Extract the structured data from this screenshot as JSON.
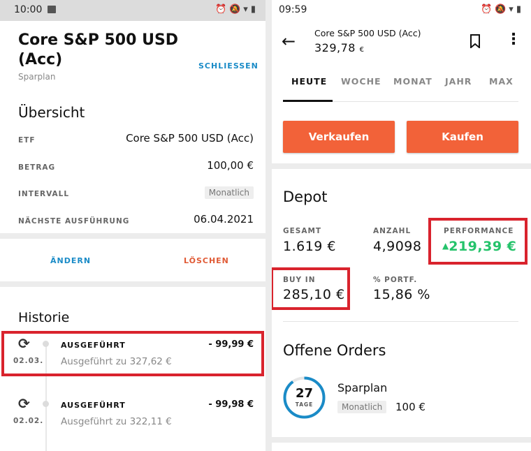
{
  "left": {
    "status_time": "10:00",
    "title": "Core S&P 500 USD (Acc)",
    "subtitle": "Sparplan",
    "close_label": "SCHLIESSEN",
    "overview_heading": "Übersicht",
    "rows": [
      {
        "label": "ETF",
        "value": "Core S&P 500 USD (Acc)"
      },
      {
        "label": "BETRAG",
        "value": "100,00 €"
      },
      {
        "label": "INTERVALL",
        "value": "Monatlich"
      },
      {
        "label": "NÄCHSTE AUSFÜHRUNG",
        "value": "06.04.2021"
      }
    ],
    "edit_label": "ÄNDERN",
    "delete_label": "LÖSCHEN",
    "history_heading": "Historie",
    "history": [
      {
        "date": "02.03.",
        "title": "AUSGEFÜHRT",
        "amount": "- 99,99 €",
        "detail": "Ausgeführt zu 327,62 €"
      },
      {
        "date": "02.02.",
        "title": "AUSGEFÜHRT",
        "amount": "- 99,98 €",
        "detail": "Ausgeführt zu 322,11 €"
      }
    ]
  },
  "right": {
    "status_time": "09:59",
    "header_name": "Core S&P 500 USD (Acc)",
    "header_price": "329,78",
    "header_currency": "€",
    "tabs": [
      "HEUTE",
      "WOCHE",
      "MONAT",
      "JAHR",
      "MAX"
    ],
    "active_tab": "HEUTE",
    "sell_label": "Verkaufen",
    "buy_label": "Kaufen",
    "depot_heading": "Depot",
    "depot": {
      "gesamt_label": "GESAMT",
      "gesamt": "1.619 €",
      "anzahl_label": "ANZAHL",
      "anzahl": "4,9098",
      "performance_label": "PERFORMANCE",
      "performance": "219,39 €",
      "buyin_label": "BUY IN",
      "buyin": "285,10 €",
      "portf_label": "% PORTF.",
      "portf": "15,86 %"
    },
    "orders_heading": "Offene Orders",
    "order": {
      "days": "27",
      "days_label": "TAGE",
      "days_progress": 0.9,
      "name": "Sparplan",
      "interval": "Monatlich",
      "amount": "100 €"
    }
  },
  "colors": {
    "accent_orange": "#f26239",
    "highlight_red": "#d9232d",
    "positive_green": "#25c36b",
    "link_blue": "#1a8bc7"
  }
}
